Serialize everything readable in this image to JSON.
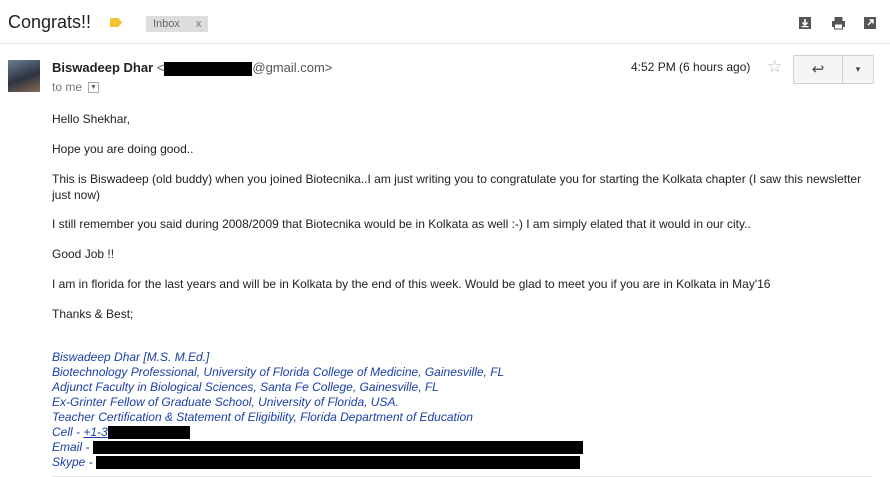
{
  "subject": "Congrats!!",
  "label_chip": {
    "text": "Inbox",
    "close": "x"
  },
  "toolbar": {
    "download_icon": "download-icon",
    "print_icon": "print-icon",
    "newwindow_icon": "open-in-new-window-icon"
  },
  "sender": {
    "name": "Biswadeep Dhar",
    "open": "<",
    "domain": "@gmail.com>"
  },
  "recipient": "to me",
  "time": "4:52 PM (6 hours ago)",
  "actions": {
    "star": "☆",
    "reply": "↩",
    "more": "▾"
  },
  "body": {
    "greeting": "Hello Shekhar,",
    "p1": "Hope you are doing good..",
    "p2": "This is Biswadeep (old buddy) when you joined Biotecnika..I am just writing you to congratulate you for starting the Kolkata chapter (I saw this newsletter just now)",
    "p3": "I still remember you said during 2008/2009 that Biotecnika would be in Kolkata as well :-) I am simply elated that it would in our city..",
    "p4": "Good Job !!",
    "p5": "I am in florida for the last years and will be in Kolkata by the end of this week. Would be glad to meet you if you are in Kolkata in May'16",
    "p6": "Thanks & Best;"
  },
  "signature": {
    "line1": "Biswadeep Dhar [M.S. M.Ed.]",
    "line2": "Biotechnology Professional, University of Florida College of Medicine, Gainesville, FL",
    "line3": "Adjunct Faculty in Biological Sciences, Santa Fe College, Gainesville, FL",
    "line4": "Ex-Grinter Fellow of Graduate School, University of Florida, USA.",
    "line5": "Teacher Certification & Statement of Eligibility, Florida Department of Education",
    "cell_label": "Cell - ",
    "cell_value": "+1-3",
    "email_label": "Email - ",
    "skype_label": "Skype - "
  }
}
